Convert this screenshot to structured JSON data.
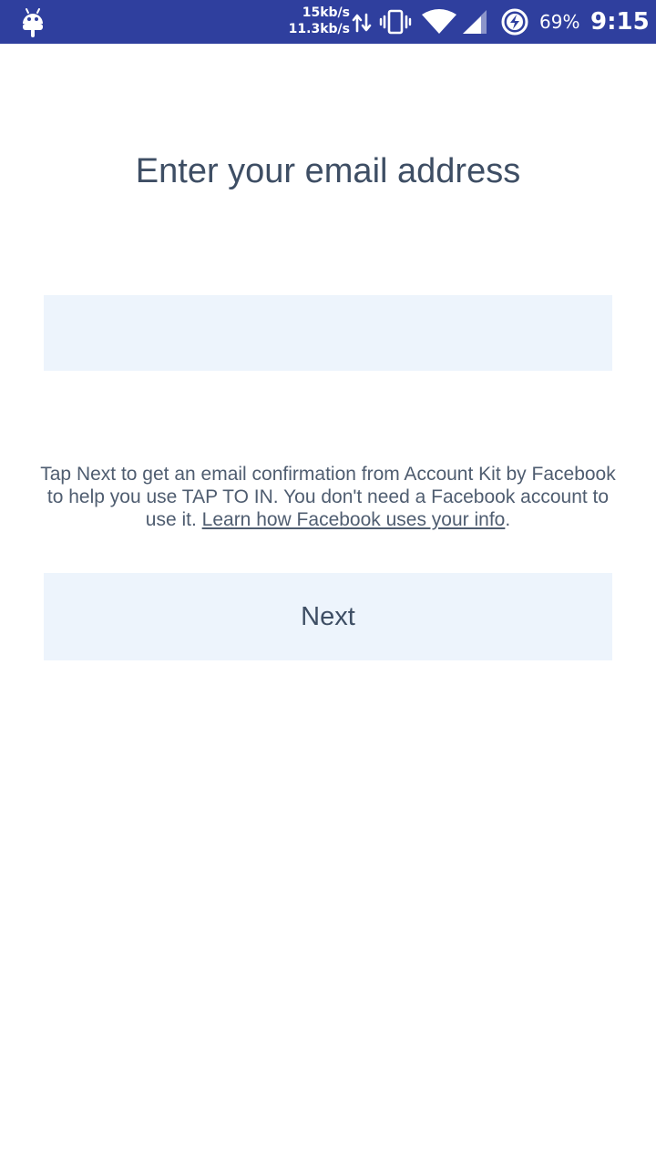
{
  "status_bar": {
    "download_speed": "15kb/s",
    "upload_speed": "11.3kb/s",
    "battery_percent": "69%",
    "time": "9:15",
    "background_color": "#2f3f9e",
    "icons": [
      "android-icon",
      "data-transfer-icon",
      "vibrate-icon",
      "wifi-icon",
      "cell-signal-icon",
      "battery-saver-icon"
    ]
  },
  "main": {
    "title": "Enter your email address",
    "email_input": {
      "value": "",
      "placeholder": ""
    },
    "info_text_prefix": "Tap Next to get an email confirmation from Account Kit by Facebook to help you use TAP TO IN. You don't need a Facebook account to use it. ",
    "info_link": "Learn how Facebook uses your info",
    "info_text_suffix": ".",
    "next_label": "Next",
    "field_background": "#edf4fc",
    "text_color": "#3e4e64"
  }
}
